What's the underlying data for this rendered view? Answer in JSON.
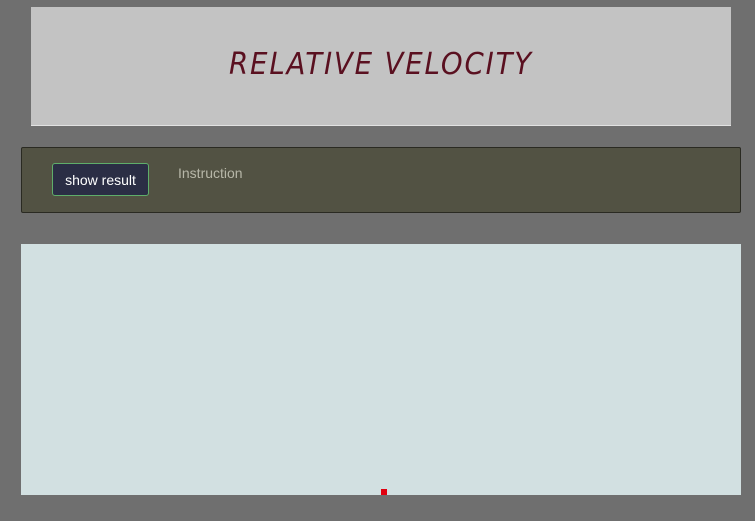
{
  "header": {
    "title": "RELATIVE VELOCITY"
  },
  "controls": {
    "show_result_label": "show result",
    "instruction_label": "Instruction"
  },
  "simulation": {
    "marker_color": "#e0000f"
  }
}
